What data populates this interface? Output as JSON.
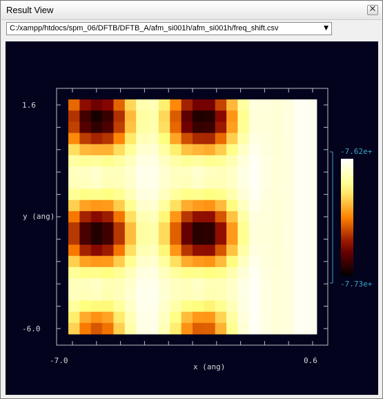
{
  "window": {
    "title": "Result View",
    "close_glyph": "✕"
  },
  "toolbar": {
    "file_path": "C:/xampp/htdocs/spm_06/DFTB/DFTB_A/afm_si001h/afm_si001h/freq_shift.csv",
    "dropdown_icon": "▼"
  },
  "chart_data": {
    "type": "heatmap",
    "xlabel": "x (ang)",
    "ylabel": "y (ang)",
    "x_tick_labels": [
      "-7.0",
      "0.6"
    ],
    "y_tick_labels": [
      "1.6",
      "-6.0"
    ],
    "xlim": [
      -7.0,
      0.6
    ],
    "ylim": [
      -6.0,
      1.6
    ],
    "grid_cols": 22,
    "grid_rows": 21,
    "colorbar": {
      "max_label": "-7.62e+",
      "min_label": "-7.73e+",
      "colormap": "afmhot"
    },
    "period_cells": 9.3,
    "wells": [
      {
        "col": 2.5,
        "row": 1.8,
        "depth": 1.0,
        "radius": 3.0
      },
      {
        "col": 11.8,
        "row": 1.8,
        "depth": 1.0,
        "radius": 3.0
      },
      {
        "col": 2.5,
        "row": 12.0,
        "depth": 1.0,
        "radius": 3.0
      },
      {
        "col": 11.8,
        "row": 12.0,
        "depth": 1.0,
        "radius": 3.0
      },
      {
        "col": 2.5,
        "row": 20.6,
        "depth": 0.6,
        "radius": 2.4
      },
      {
        "col": 11.8,
        "row": 20.6,
        "depth": 0.6,
        "radius": 2.4
      }
    ]
  }
}
